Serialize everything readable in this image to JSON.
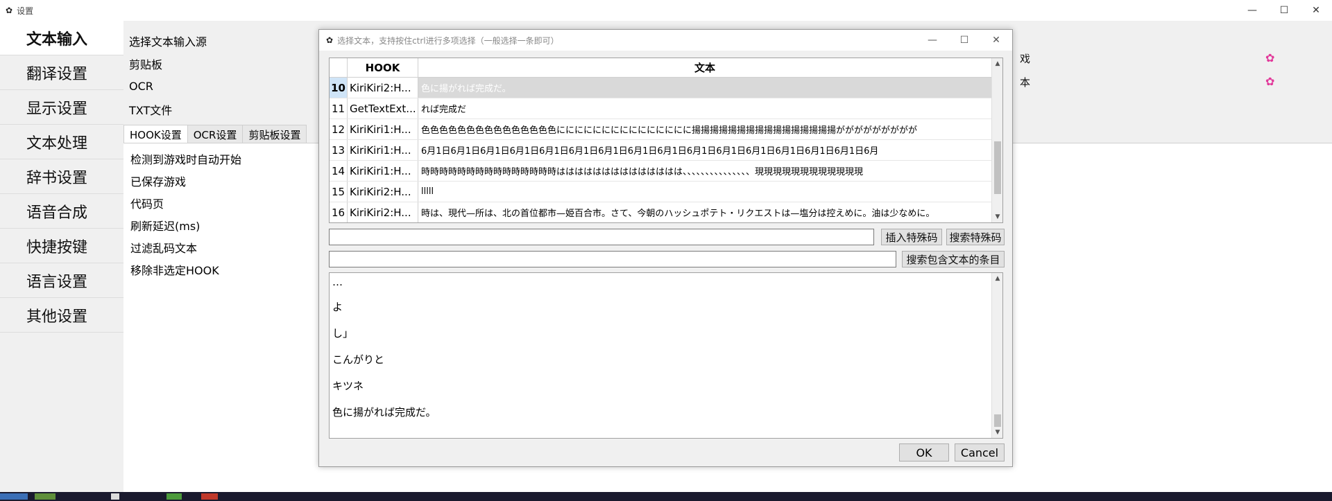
{
  "main_window": {
    "title": "设置",
    "controls": {
      "minimize": "—",
      "maximize": "☐",
      "close": "✕"
    }
  },
  "sidebar": {
    "items": [
      {
        "label": "文本输入"
      },
      {
        "label": "翻译设置"
      },
      {
        "label": "显示设置"
      },
      {
        "label": "文本处理"
      },
      {
        "label": "辞书设置"
      },
      {
        "label": "语音合成"
      },
      {
        "label": "快捷按键"
      },
      {
        "label": "语言设置"
      },
      {
        "label": "其他设置"
      }
    ]
  },
  "content": {
    "sources": [
      "选择文本输入源",
      "剪贴板",
      "OCR",
      "TXT文件"
    ],
    "right_labels": [
      "戏",
      "本"
    ],
    "tabs": [
      "HOOK设置",
      "OCR设置",
      "剪贴板设置"
    ],
    "hook_options": [
      "检测到游戏时自动开始",
      "已保存游戏",
      "代码页",
      "刷新延迟(ms)",
      "过滤乱码文本",
      "移除非选定HOOK"
    ]
  },
  "dialog": {
    "title": "选择文本，支持按住ctrl进行多项选择（一般选择一条即可）",
    "controls": {
      "minimize": "—",
      "maximize": "☐",
      "close": "✕"
    },
    "table": {
      "headers": [
        "HOOK",
        "文本"
      ],
      "rows": [
        {
          "num": "10",
          "hook": "KiriKiri2:H...",
          "text": "色に揚がれば完成だ。"
        },
        {
          "num": "11",
          "hook": "GetTextExt...",
          "text": "れば完成だ"
        },
        {
          "num": "12",
          "hook": "KiriKiri1:H...",
          "text": "色色色色色色色色色色色色色色色ににににににににににににににに揚揚揚揚揚揚揚揚揚揚揚揚揚揚揚揚ががががががががが"
        },
        {
          "num": "13",
          "hook": "KiriKiri1:H...",
          "text": "6月1日6月1日6月1日6月1日6月1日6月1日6月1日6月1日6月1日6月1日6月1日6月1日6月1日6月1日6月1日6月"
        },
        {
          "num": "14",
          "hook": "KiriKiri1:H...",
          "text": "時時時時時時時時時時時時時時時はははははははははははははは、、、、、、、、、、、、、、、現現現現現現現現現現現現"
        },
        {
          "num": "15",
          "hook": "KiriKiri2:H...",
          "text": "lllll"
        },
        {
          "num": "16",
          "hook": "KiriKiri2:H...",
          "text": "時は、現代—所は、北の首位都市—姫百合市。さて、今朝のハッシュポテト・リクエストは—塩分は控えめに。油は少なめに。"
        }
      ]
    },
    "insert_special": "插入特殊码",
    "search_special": "搜索特殊码",
    "search_contains": "搜索包含文本的条目",
    "preview_lines": [
      "…",
      "よ",
      "し」",
      "こんがりと",
      "キツネ",
      "色に揚がれば完成だ。"
    ],
    "ok_label": "OK",
    "cancel_label": "Cancel"
  },
  "colors": {
    "accent_gear": "#e2389a",
    "selected_row_bg": "#d9d9d9",
    "selected_num_bg": "#cfe4f7"
  }
}
